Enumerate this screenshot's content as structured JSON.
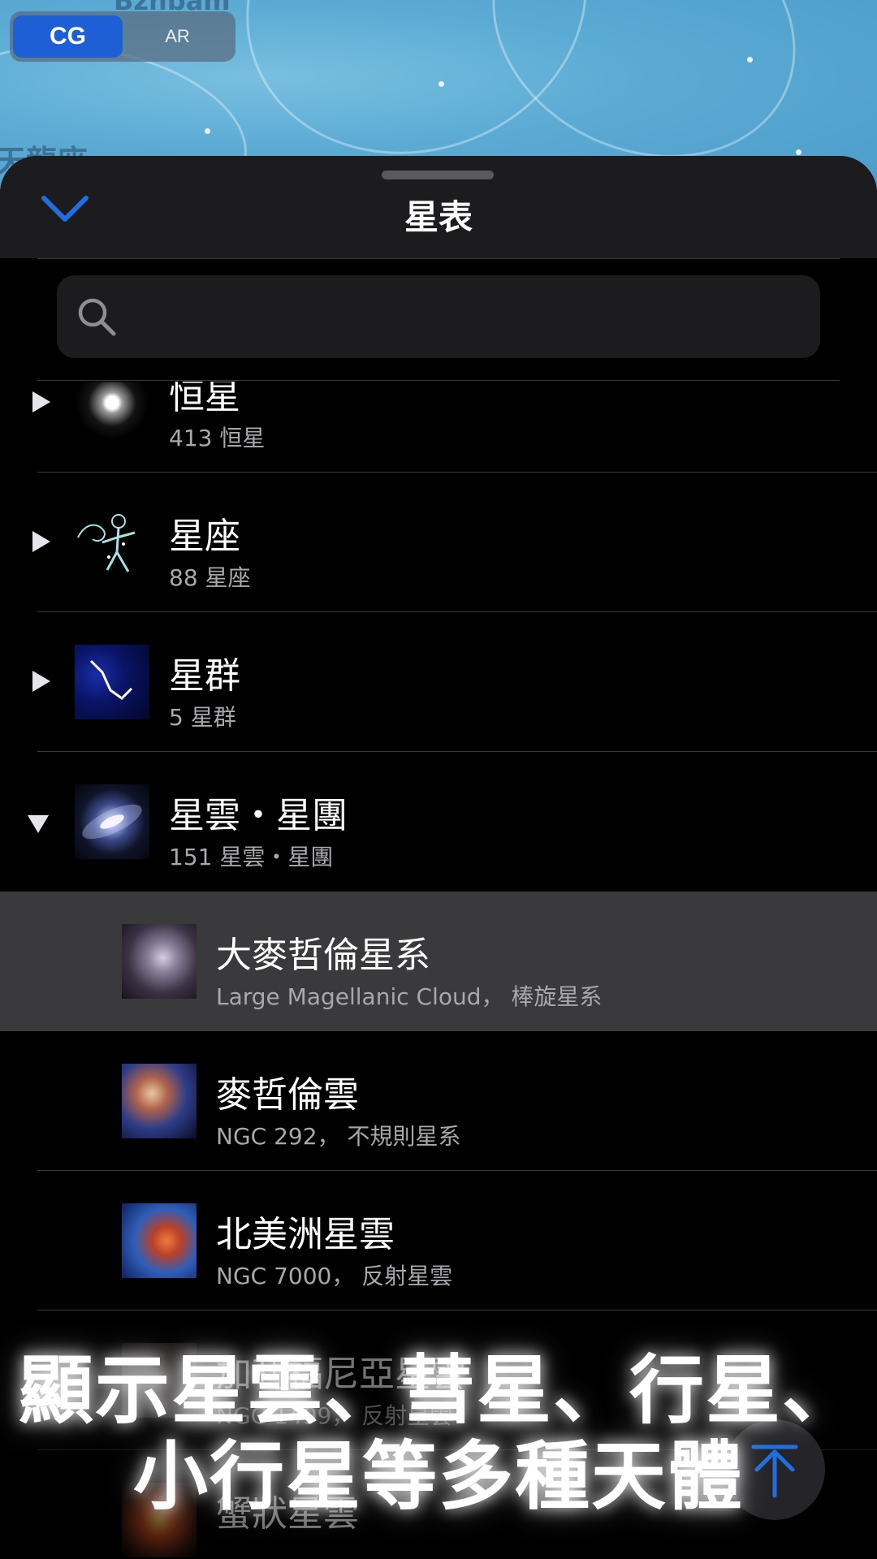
{
  "map": {
    "top_label": "Bzhbam",
    "left_label": "天龍座",
    "mode_toggle": {
      "options": [
        "CG",
        "AR"
      ],
      "selected": "CG"
    }
  },
  "sheet": {
    "title": "星表",
    "search": {
      "placeholder": "",
      "value": ""
    }
  },
  "list": {
    "categories": [
      {
        "title": "恒星",
        "subtitle": "413 恒星",
        "expanded": false,
        "thumb_icon": "star-thumbnail"
      },
      {
        "title": "星座",
        "subtitle": "88 星座",
        "expanded": false,
        "thumb_icon": "constellation-thumbnail"
      },
      {
        "title": "星群",
        "subtitle": "5 星群",
        "expanded": false,
        "thumb_icon": "asterism-thumbnail"
      },
      {
        "title": "星雲・星團",
        "subtitle": "151 星雲・星團",
        "expanded": true,
        "thumb_icon": "galaxy-thumbnail"
      }
    ],
    "items": [
      {
        "title": "大麥哲倫星系",
        "subtitle": "Large Magellanic Cloud，  棒旋星系",
        "selected": true
      },
      {
        "title": "麥哲倫雲",
        "subtitle": "NGC 292，  不規則星系",
        "selected": false
      },
      {
        "title": "北美洲星雲",
        "subtitle": "NGC 7000，  反射星雲",
        "selected": false
      },
      {
        "title": "加利福尼亞星雲",
        "subtitle": "NGC 1499，  反射星雲",
        "selected": false
      },
      {
        "title": "蟹狀星雲",
        "subtitle": "",
        "selected": false
      }
    ]
  },
  "promo": {
    "line1": "顯示星雲、彗星、行星、",
    "line2": "小行星等多種天體"
  },
  "colors": {
    "accent_blue": "#1f6fe0",
    "selected_row": "#3a3a3c",
    "header_bg": "#1c1c1e"
  }
}
